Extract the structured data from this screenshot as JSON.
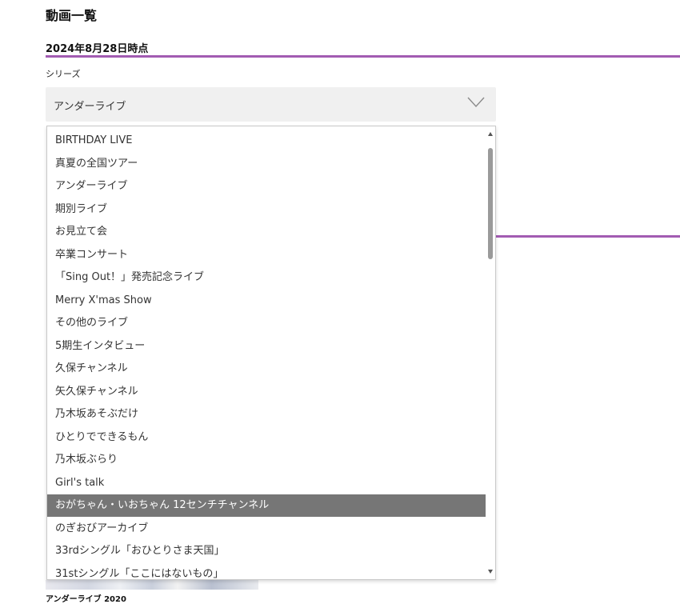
{
  "page": {
    "title": "動画一覧",
    "date_heading": "2024年8月28日時点",
    "accent_color": "#a25bb2"
  },
  "filter": {
    "label": "シリーズ",
    "selected_value": "アンダーライブ",
    "chevron_icon": "chevron-down-icon"
  },
  "dropdown": {
    "highlighted_index": 16,
    "options": [
      "BIRTHDAY LIVE",
      "真夏の全国ツアー",
      "アンダーライブ",
      "期別ライブ",
      "お見立て会",
      "卒業コンサート",
      "「Sing Out！」発売記念ライブ",
      "Merry X'mas Show",
      "その他のライブ",
      "5期生インタビュー",
      "久保チャンネル",
      "矢久保チャンネル",
      "乃木坂あそぶだけ",
      "ひとりでできるもん",
      "乃木坂ぶらり",
      "Girl's talk",
      "おがちゃん・いおちゃん 12センチチャンネル",
      "のぎおびアーカイブ",
      "33rdシングル「おひとりさま天国」",
      "31stシングル「ここにはないもの」"
    ]
  },
  "video": {
    "caption": "アンダーライブ 2020"
  }
}
